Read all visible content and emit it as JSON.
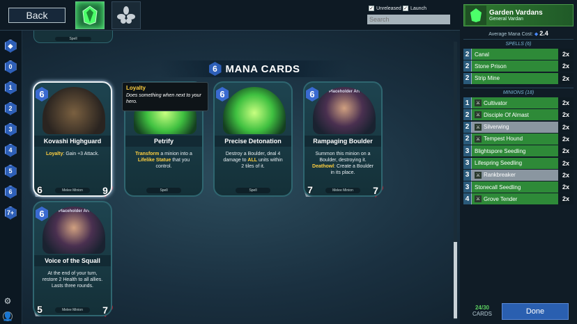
{
  "topbar": {
    "back_label": "Back",
    "unreleased_label": "Unreleased",
    "launch_label": "Launch",
    "search_placeholder": "Search"
  },
  "mana_filters": [
    "0",
    "1",
    "2",
    "3",
    "4",
    "5",
    "6",
    "7+"
  ],
  "section": {
    "cost": "6",
    "title": "MANA CARDS"
  },
  "top_partial_card": {
    "type": "Spell"
  },
  "cards": [
    {
      "name": "Kovashi Highguard",
      "mana": "6",
      "desc_kw": "Loyalty",
      "desc": ": Gain +3 Attack.",
      "type": "Melee Minion",
      "atk": "6",
      "hp": "9"
    },
    {
      "name": "Petrify",
      "mana": "",
      "desc_kw": "Transform",
      "desc": " a minion into a ",
      "desc_kw2": "Lifelike Statue",
      "desc2": " that you control.",
      "type": "Spell"
    },
    {
      "name": "Precise Detonation",
      "mana": "6",
      "desc": "Destroy a Boulder, deal 4 damage to ",
      "desc_kw": "ALL",
      "desc2": " units within 2 tiles of it.",
      "type": "Spell"
    },
    {
      "name": "Rampaging Boulder",
      "mana": "6",
      "placeholder": "Placeholder Art",
      "desc": "Summon this minion on a Boulder, destroying it. ",
      "desc_kw": "Deathowl",
      "desc2": ": Create a Boulder in its place.",
      "type": "Melee Minion",
      "atk": "7",
      "hp": "7"
    },
    {
      "name": "Voice of the Squall",
      "mana": "6",
      "placeholder": "Placeholder Art",
      "desc": "At the end of your turn, restore 2 Health to all allies. Lasts three rounds.",
      "type": "Melee Minion",
      "atk": "5",
      "hp": "7"
    }
  ],
  "tooltip": {
    "title": "Loyalty",
    "text": "Does something when next to your hero."
  },
  "deck": {
    "general_name": "Garden Vardans",
    "general_title": "General Vardan",
    "avg_label": "Average Mana Cost:",
    "avg_value": "2.4",
    "spells_header": "SPELLS (6)",
    "spells": [
      {
        "cost": "2",
        "name": "Canal",
        "qty": "2x"
      },
      {
        "cost": "2",
        "name": "Stone Prison",
        "qty": "2x"
      },
      {
        "cost": "2",
        "name": "Strip Mine",
        "qty": "2x"
      }
    ],
    "minions_header": "MINIONS (18)",
    "minions": [
      {
        "cost": "1",
        "name": "Cultivator",
        "qty": "2x",
        "grey": false,
        "icon": true
      },
      {
        "cost": "2",
        "name": "Disciple Of Almast",
        "qty": "2x",
        "grey": false,
        "icon": true
      },
      {
        "cost": "2",
        "name": "Silverwing",
        "qty": "2x",
        "grey": true,
        "icon": true
      },
      {
        "cost": "2",
        "name": "Tempest Hound",
        "qty": "2x",
        "grey": false,
        "icon": true
      },
      {
        "cost": "3",
        "name": "Blightspore Seedling",
        "qty": "2x",
        "grey": false,
        "icon": false
      },
      {
        "cost": "3",
        "name": "Lifespring Seedling",
        "qty": "2x",
        "grey": false,
        "icon": false
      },
      {
        "cost": "3",
        "name": "Rankbreaker",
        "qty": "2x",
        "grey": true,
        "icon": true
      },
      {
        "cost": "3",
        "name": "Stonecall Seedling",
        "qty": "2x",
        "grey": false,
        "icon": false
      },
      {
        "cost": "4",
        "name": "Grove Tender",
        "qty": "2x",
        "grey": false,
        "icon": true
      }
    ],
    "count": "24/30",
    "count_label": "CARDS",
    "done_label": "Done"
  },
  "colors": {
    "accent": "#2e8a38",
    "mana": "#2d5fb8",
    "done": "#2a5fb0"
  }
}
